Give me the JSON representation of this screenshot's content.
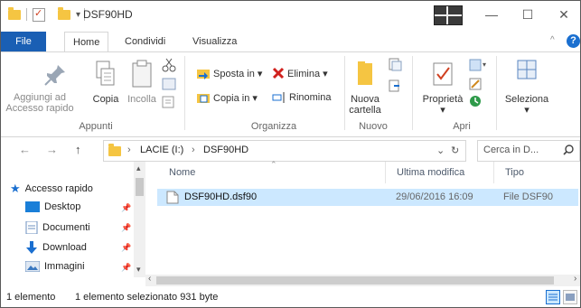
{
  "window": {
    "title": "DSF90HD",
    "minimize_glyph": "—",
    "maximize_glyph": "☐",
    "close_glyph": "✕"
  },
  "ribbon_tabs": [
    "File",
    "Home",
    "Condividi",
    "Visualizza"
  ],
  "ribbon_caret": "^",
  "help_glyph": "?",
  "ribbon": {
    "appunti": {
      "label": "Appunti",
      "pin_line1": "Aggiungi ad",
      "pin_line2": "Accesso rapido",
      "copy": "Copia",
      "paste": "Incolla"
    },
    "organizza": {
      "label": "Organizza",
      "move_to": "Sposta in ▾",
      "copy_to": "Copia in ▾",
      "delete": "Elimina ▾",
      "rename": "Rinomina"
    },
    "nuovo": {
      "label": "Nuovo",
      "new_folder_line1": "Nuova",
      "new_folder_line2": "cartella"
    },
    "apri": {
      "label": "Apri",
      "properties": "Proprietà",
      "properties_caret": "▾"
    },
    "seleziona": {
      "label": "Seleziona",
      "caret": "▾"
    }
  },
  "address_bar": {
    "back": "←",
    "forward": "→",
    "up": "↑",
    "segments": [
      "LACIE (I:)",
      "DSF90HD"
    ],
    "separator": "›",
    "dropdown": "⌄",
    "refresh": "↻",
    "search_placeholder": "Cerca in D..."
  },
  "nav_pane": {
    "quick_access": "Accesso rapido",
    "items": [
      "Desktop",
      "Documenti",
      "Download",
      "Immagini"
    ]
  },
  "file_list": {
    "columns": [
      "Nome",
      "Ultima modifica",
      "Tipo"
    ],
    "rows": [
      {
        "name": "DSF90HD.dsf90",
        "modified": "29/06/2016 16:09",
        "type": "File DSF90"
      }
    ]
  },
  "status_bar": {
    "count": "1 elemento",
    "selection": "1 elemento selezionato 931 byte"
  },
  "colors": {
    "accent": "#1a5fb4",
    "selection": "#cce8ff",
    "folder": "#f5c542",
    "delete_red": "#d0211d"
  }
}
